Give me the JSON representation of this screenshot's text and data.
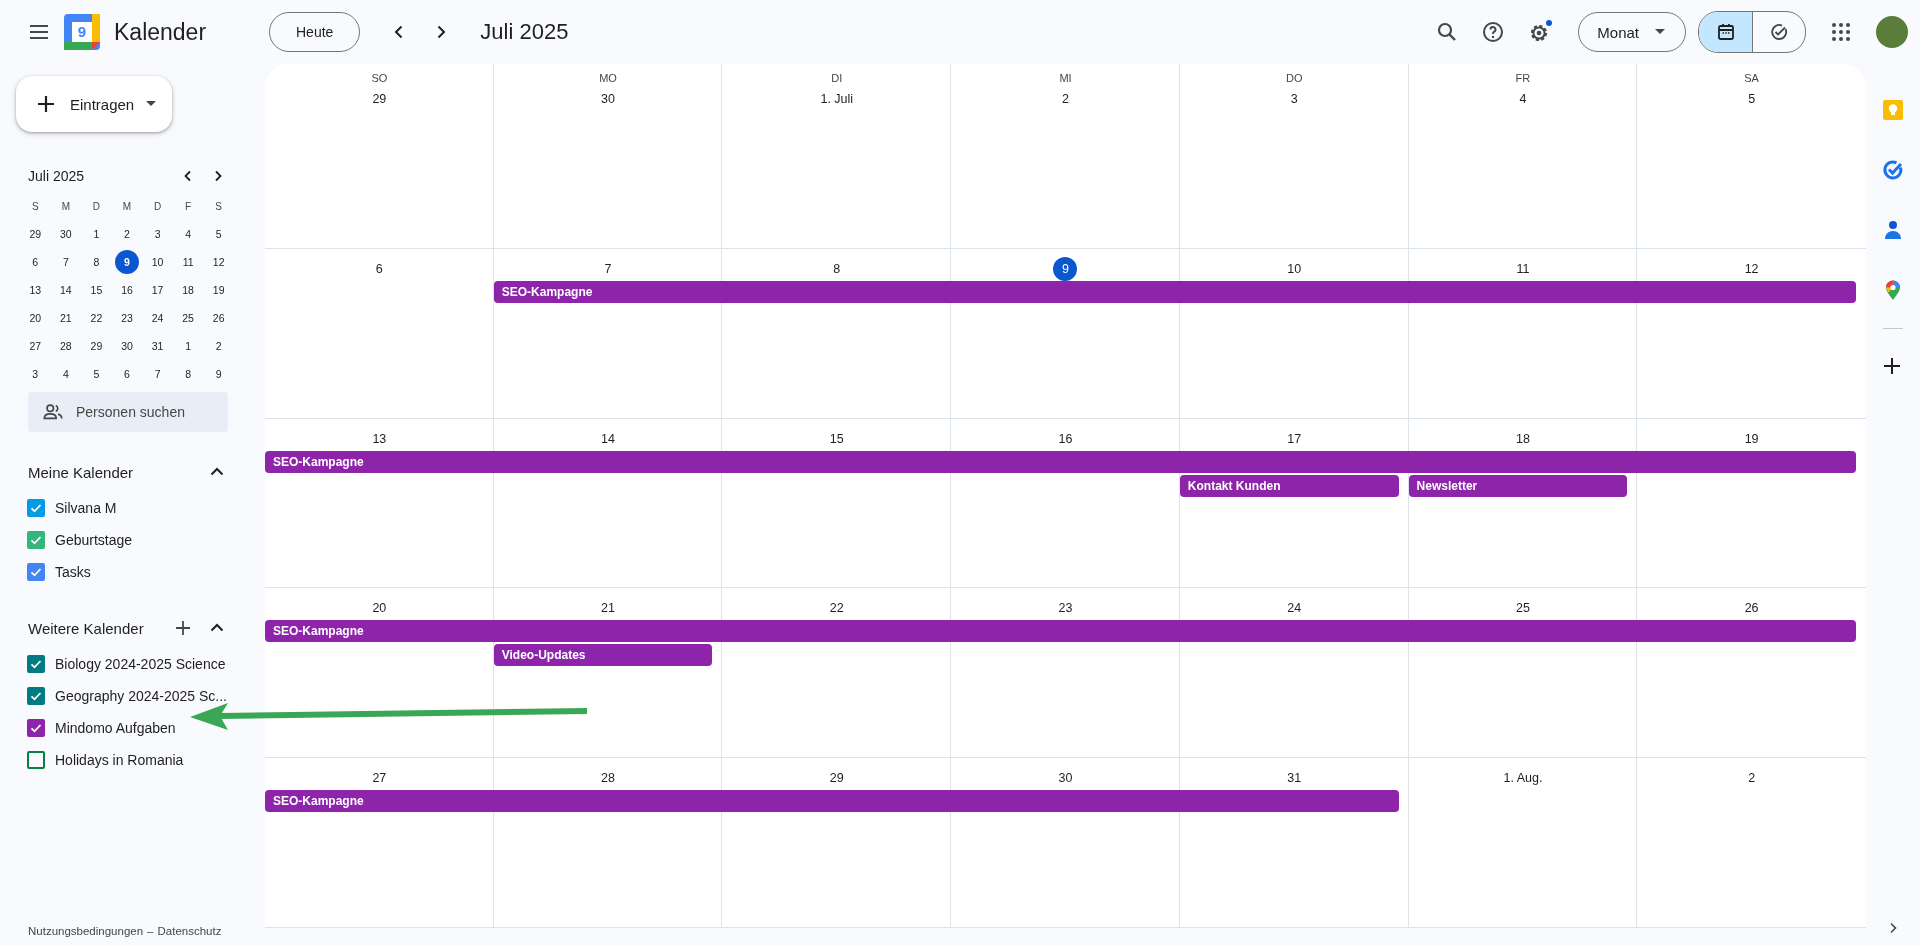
{
  "header": {
    "app_name": "Kalender",
    "logo_text": "9",
    "today_button": "Heute",
    "period": "Juli 2025",
    "view_button": "Monat",
    "view_toggle": [
      {
        "kind": "calendar",
        "selected": true
      },
      {
        "kind": "tasks",
        "selected": false
      }
    ],
    "settings_badge": true
  },
  "sidebar": {
    "create_button": "Eintragen",
    "mini_calendar": {
      "title": "Juli 2025",
      "weekdays": [
        "S",
        "M",
        "D",
        "M",
        "D",
        "F",
        "S"
      ],
      "weeks": [
        [
          {
            "label": "29",
            "today": false
          },
          {
            "label": "30",
            "today": false
          },
          {
            "label": "1",
            "today": false
          },
          {
            "label": "2",
            "today": false
          },
          {
            "label": "3",
            "today": false
          },
          {
            "label": "4",
            "today": false
          },
          {
            "label": "5",
            "today": false
          }
        ],
        [
          {
            "label": "6",
            "today": false
          },
          {
            "label": "7",
            "today": false
          },
          {
            "label": "8",
            "today": false
          },
          {
            "label": "9",
            "today": true
          },
          {
            "label": "10",
            "today": false
          },
          {
            "label": "11",
            "today": false
          },
          {
            "label": "12",
            "today": false
          }
        ],
        [
          {
            "label": "13",
            "today": false
          },
          {
            "label": "14",
            "today": false
          },
          {
            "label": "15",
            "today": false
          },
          {
            "label": "16",
            "today": false
          },
          {
            "label": "17",
            "today": false
          },
          {
            "label": "18",
            "today": false
          },
          {
            "label": "19",
            "today": false
          }
        ],
        [
          {
            "label": "20",
            "today": false
          },
          {
            "label": "21",
            "today": false
          },
          {
            "label": "22",
            "today": false
          },
          {
            "label": "23",
            "today": false
          },
          {
            "label": "24",
            "today": false
          },
          {
            "label": "25",
            "today": false
          },
          {
            "label": "26",
            "today": false
          }
        ],
        [
          {
            "label": "27",
            "today": false
          },
          {
            "label": "28",
            "today": false
          },
          {
            "label": "29",
            "today": false
          },
          {
            "label": "30",
            "today": false
          },
          {
            "label": "31",
            "today": false
          },
          {
            "label": "1",
            "today": false
          },
          {
            "label": "2",
            "today": false
          }
        ],
        [
          {
            "label": "3",
            "today": false
          },
          {
            "label": "4",
            "today": false
          },
          {
            "label": "5",
            "today": false
          },
          {
            "label": "6",
            "today": false
          },
          {
            "label": "7",
            "today": false
          },
          {
            "label": "8",
            "today": false
          },
          {
            "label": "9",
            "today": false
          }
        ]
      ]
    },
    "people_search": {
      "placeholder": "Personen suchen"
    },
    "my_calendars": {
      "title": "Meine Kalender",
      "expanded": true,
      "items": [
        {
          "name": "Silvana M",
          "checked": true,
          "color": "#039be5"
        },
        {
          "name": "Geburtstage",
          "checked": true,
          "color": "#33b679"
        },
        {
          "name": "Tasks",
          "checked": true,
          "color": "#4285f4"
        }
      ]
    },
    "other_calendars": {
      "title": "Weitere Kalender",
      "expanded": true,
      "items": [
        {
          "name": "Biology 2024-2025 Science",
          "checked": true,
          "color": "#007b83"
        },
        {
          "name": "Geography 2024-2025 Sc...",
          "checked": true,
          "color": "#007b83"
        },
        {
          "name": "Mindomo Aufgaben",
          "checked": true,
          "color": "#8e24aa"
        },
        {
          "name": "Holidays in Romania",
          "checked": false,
          "color": "#0b8043"
        }
      ]
    },
    "footer": {
      "links": [
        "Nutzungsbedingungen",
        "Datenschutz"
      ],
      "separator": "–"
    }
  },
  "month": {
    "weekdays": [
      "SO",
      "MO",
      "DI",
      "MI",
      "DO",
      "FR",
      "SA"
    ],
    "weeks": [
      {
        "days": [
          {
            "label": "29",
            "today": false
          },
          {
            "label": "30",
            "today": false
          },
          {
            "label": "1. Juli",
            "today": false
          },
          {
            "label": "2",
            "today": false
          },
          {
            "label": "3",
            "today": false
          },
          {
            "label": "4",
            "today": false
          },
          {
            "label": "5",
            "today": false
          }
        ]
      },
      {
        "days": [
          {
            "label": "6",
            "today": false
          },
          {
            "label": "7",
            "today": false,
            "events": [
              {
                "kind": "start",
                "title": "SEO-Kampagne",
                "color": "#8e24aa"
              }
            ]
          },
          {
            "label": "8",
            "today": false,
            "events": [
              {
                "kind": "continued"
              }
            ]
          },
          {
            "label": "9",
            "today": true,
            "events": [
              {
                "kind": "continued"
              }
            ]
          },
          {
            "label": "10",
            "today": false,
            "events": [
              {
                "kind": "continued"
              }
            ]
          },
          {
            "label": "11",
            "today": false,
            "events": [
              {
                "kind": "continued"
              }
            ]
          },
          {
            "label": "12",
            "today": false,
            "events": [
              {
                "kind": "continued"
              }
            ]
          }
        ]
      },
      {
        "days": [
          {
            "label": "13",
            "today": false,
            "events": [
              {
                "kind": "start",
                "title": "SEO-Kampagne",
                "color": "#8e24aa"
              }
            ]
          },
          {
            "label": "14",
            "today": false,
            "events": [
              {
                "kind": "continued"
              }
            ]
          },
          {
            "label": "15",
            "today": false,
            "events": [
              {
                "kind": "continued"
              }
            ]
          },
          {
            "label": "16",
            "today": false,
            "events": [
              {
                "kind": "continued"
              }
            ]
          },
          {
            "label": "17",
            "today": false,
            "events": [
              {
                "kind": "continued"
              },
              {
                "kind": "start",
                "title": "Kontakt Kunden",
                "color": "#8e24aa"
              }
            ]
          },
          {
            "label": "18",
            "today": false,
            "events": [
              {
                "kind": "continued"
              },
              {
                "kind": "start",
                "title": "Newsletter",
                "color": "#8e24aa"
              }
            ]
          },
          {
            "label": "19",
            "today": false,
            "events": [
              {
                "kind": "continued"
              }
            ]
          }
        ]
      },
      {
        "days": [
          {
            "label": "20",
            "today": false,
            "events": [
              {
                "kind": "start",
                "title": "SEO-Kampagne",
                "color": "#8e24aa"
              }
            ]
          },
          {
            "label": "21",
            "today": false,
            "events": [
              {
                "kind": "continued"
              },
              {
                "kind": "start",
                "title": "Video-Updates",
                "color": "#8e24aa"
              }
            ]
          },
          {
            "label": "22",
            "today": false,
            "events": [
              {
                "kind": "continued"
              }
            ]
          },
          {
            "label": "23",
            "today": false,
            "events": [
              {
                "kind": "continued"
              }
            ]
          },
          {
            "label": "24",
            "today": false,
            "events": [
              {
                "kind": "continued"
              }
            ]
          },
          {
            "label": "25",
            "today": false,
            "events": [
              {
                "kind": "continued"
              }
            ]
          },
          {
            "label": "26",
            "today": false,
            "events": [
              {
                "kind": "continued"
              }
            ]
          }
        ]
      },
      {
        "days": [
          {
            "label": "27",
            "today": false,
            "events": [
              {
                "kind": "start",
                "title": "SEO-Kampagne",
                "color": "#8e24aa"
              }
            ]
          },
          {
            "label": "28",
            "today": false,
            "events": [
              {
                "kind": "continued"
              }
            ]
          },
          {
            "label": "29",
            "today": false,
            "events": [
              {
                "kind": "continued"
              }
            ]
          },
          {
            "label": "30",
            "today": false,
            "events": [
              {
                "kind": "continued"
              }
            ]
          },
          {
            "label": "31",
            "today": false,
            "events": [
              {
                "kind": "continued"
              }
            ]
          },
          {
            "label": "1. Aug.",
            "today": false
          },
          {
            "label": "2",
            "today": false
          }
        ]
      }
    ]
  }
}
